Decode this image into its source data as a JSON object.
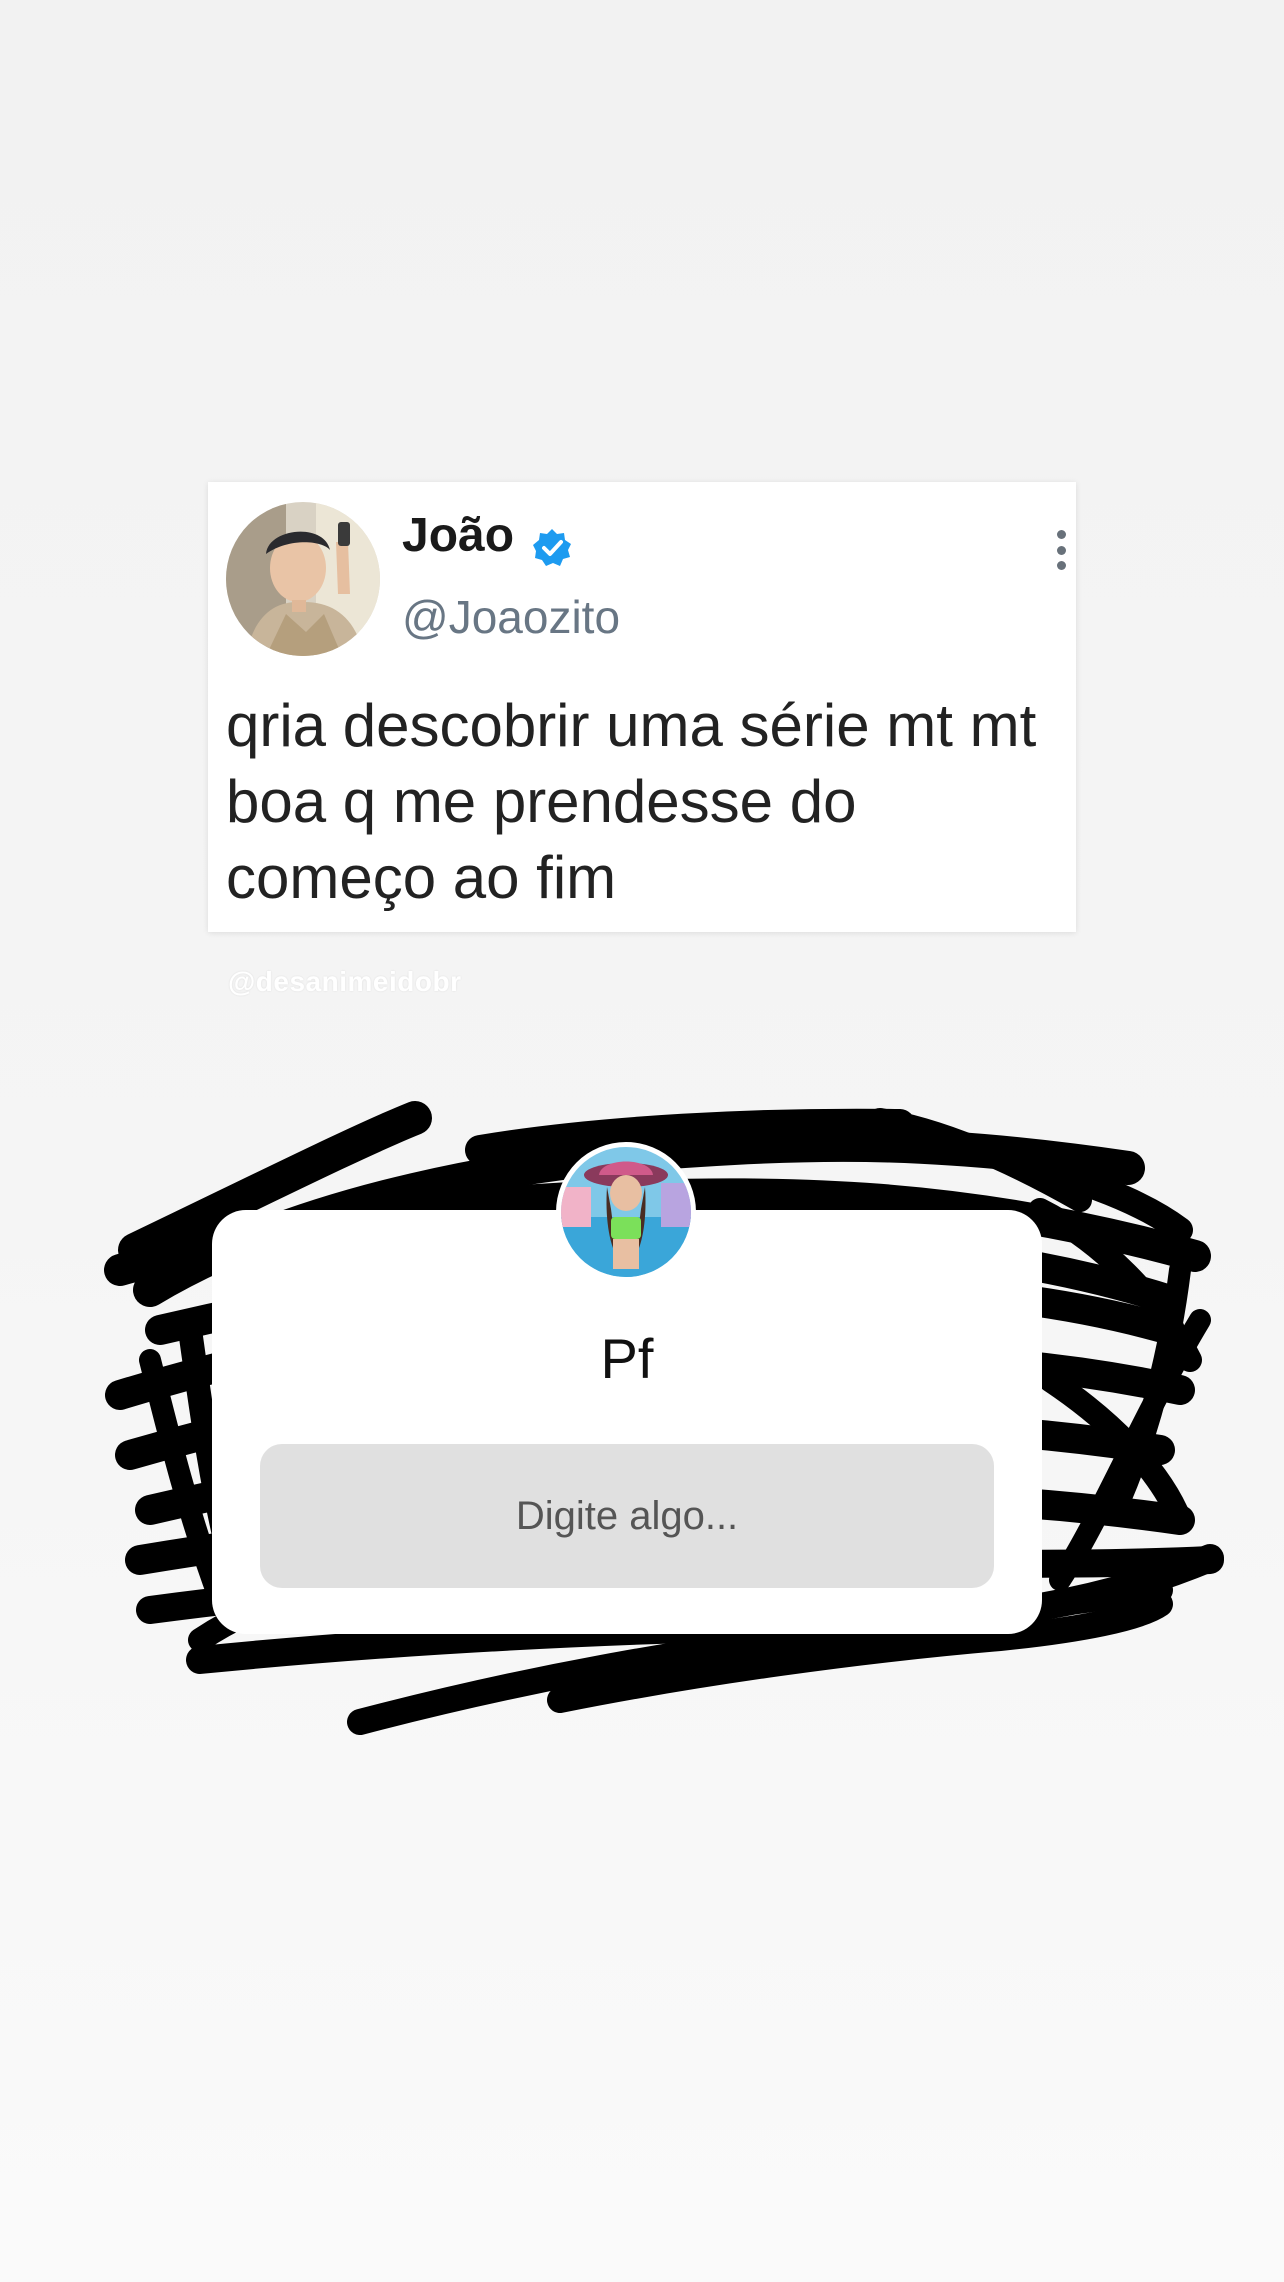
{
  "tweet": {
    "name": "João",
    "handle": "@Joaozito",
    "text": "qria descobrir uma série mt mt boa q me prendesse do começo ao fim",
    "avatar_icon": "profile-photo",
    "verified_icon": "verified-badge-icon",
    "menu_icon": "more-vertical-icon"
  },
  "watermark": "@desanimeidobr",
  "question_sticker": {
    "question": "Pf",
    "answer_placeholder": "Digite algo...",
    "avatar_icon": "profile-photo"
  },
  "colors": {
    "verified": "#1d9bf0",
    "handle": "#687684",
    "scribble": "#000000",
    "input_background": "#e0e0e0"
  }
}
